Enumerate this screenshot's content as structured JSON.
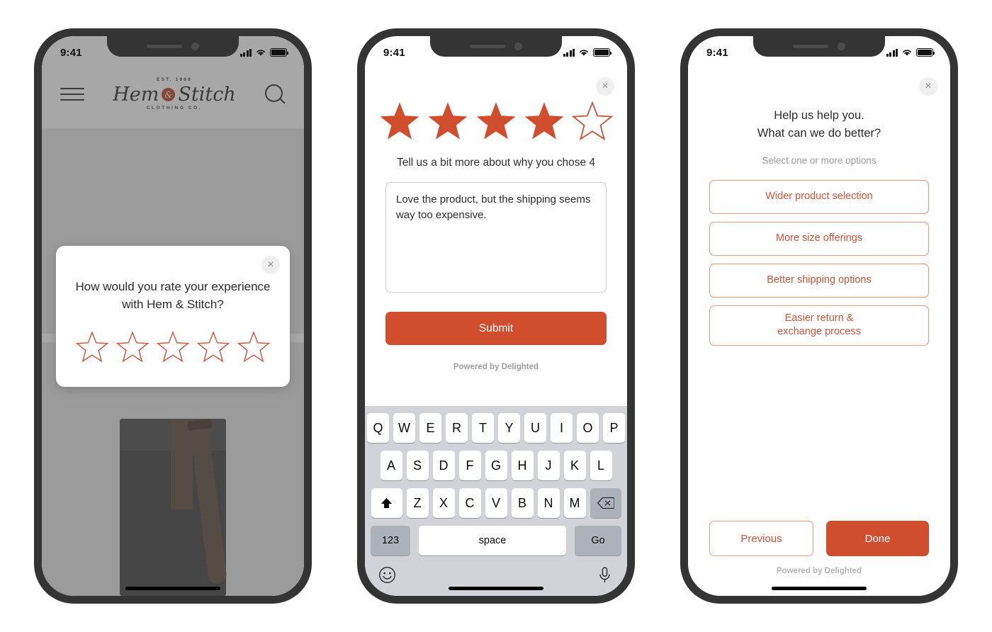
{
  "accent": "#d04d2e",
  "accent_light": "#e09b87",
  "statusbar": {
    "time": "9:41",
    "signal_icon": "cellular-bars-icon",
    "wifi_icon": "wifi-icon",
    "battery_icon": "battery-icon"
  },
  "phone1": {
    "store": {
      "menu_icon": "hamburger-menu-icon",
      "search_icon": "search-icon",
      "logo": {
        "established": "EST. 1968",
        "name_left": "Hem",
        "ampersand": "&",
        "name_right": "Stitch",
        "tagline": "CLOTHING CO."
      },
      "product1_alt": "eyeglasses-product-image",
      "product2_alt": "messenger-bag-product-image"
    },
    "survey": {
      "close_label": "×",
      "question": "How would you rate your experience with Hem & Stitch?",
      "rating_value": 0,
      "rating_max": 5
    }
  },
  "phone2": {
    "close_label": "×",
    "rating_value": 4,
    "rating_max": 5,
    "prompt": "Tell us a bit more about why you chose 4",
    "comment": "Love the product, but the shipping seems way too expensive.",
    "comment_placeholder": "",
    "submit_label": "Submit",
    "powered_by": "Powered by Delighted",
    "keyboard": {
      "row1": [
        "Q",
        "W",
        "E",
        "R",
        "T",
        "Y",
        "U",
        "I",
        "O",
        "P"
      ],
      "row2": [
        "A",
        "S",
        "D",
        "F",
        "G",
        "H",
        "J",
        "K",
        "L"
      ],
      "row3": [
        "Z",
        "X",
        "C",
        "V",
        "B",
        "N",
        "M"
      ],
      "shift_icon": "shift-arrow-icon",
      "backspace_icon": "backspace-icon",
      "numbers_label": "123",
      "space_label": "space",
      "go_label": "Go",
      "emoji_icon": "emoji-smiley-icon",
      "mic_icon": "microphone-icon"
    }
  },
  "phone3": {
    "close_label": "×",
    "title_line1": "Help us help you.",
    "title_line2": "What can we do better?",
    "subtitle": "Select one or more options",
    "options": [
      {
        "label": "Wider product selection"
      },
      {
        "label": "More size offerings"
      },
      {
        "label": "Better shipping options"
      },
      {
        "label": "Easier return &\nexchange process"
      }
    ],
    "previous_label": "Previous",
    "done_label": "Done",
    "powered_by": "Powered by Delighted"
  }
}
